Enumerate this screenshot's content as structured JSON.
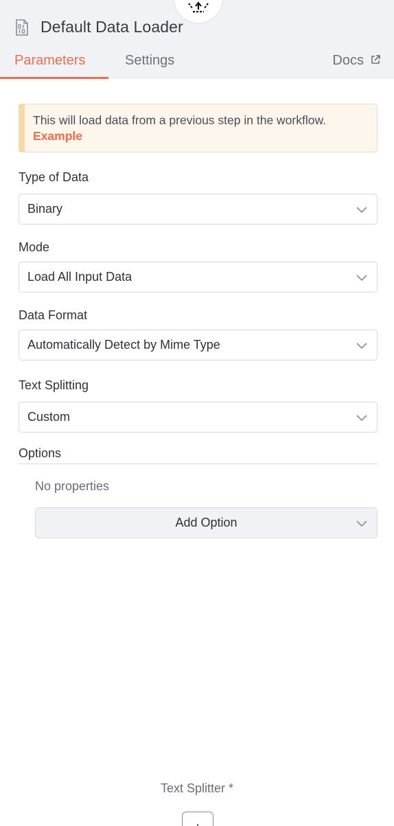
{
  "header": {
    "node_title": "Default Data Loader",
    "node_icon": "file-binary-icon",
    "connector_icon": "loader-icon"
  },
  "tabs": [
    {
      "label": "Parameters",
      "active": true
    },
    {
      "label": "Settings",
      "active": false
    },
    {
      "label": "Docs",
      "active": false,
      "icon": "external-link-icon"
    }
  ],
  "notice": {
    "text": "This will load data from a previous step in the workflow.",
    "link": "Example"
  },
  "fields": [
    {
      "label": "Type of Data",
      "value": "Binary"
    },
    {
      "label": "Mode",
      "value": "Load All Input Data"
    },
    {
      "label": "Data Format",
      "value": "Automatically Detect by Mime Type"
    },
    {
      "label": "Text Splitting",
      "value": "Custom"
    }
  ],
  "options": {
    "label": "Options",
    "empty_text": "No properties",
    "add_button": "Add Option"
  },
  "footer": {
    "splitter_label": "Text Splitter *",
    "add_symbol": "+"
  },
  "colors": {
    "accent": "#ef6c4d",
    "header_bg": "#f1f2f6",
    "notice_bg": "#fdf6ec",
    "notice_border": "#f5d9a6"
  }
}
